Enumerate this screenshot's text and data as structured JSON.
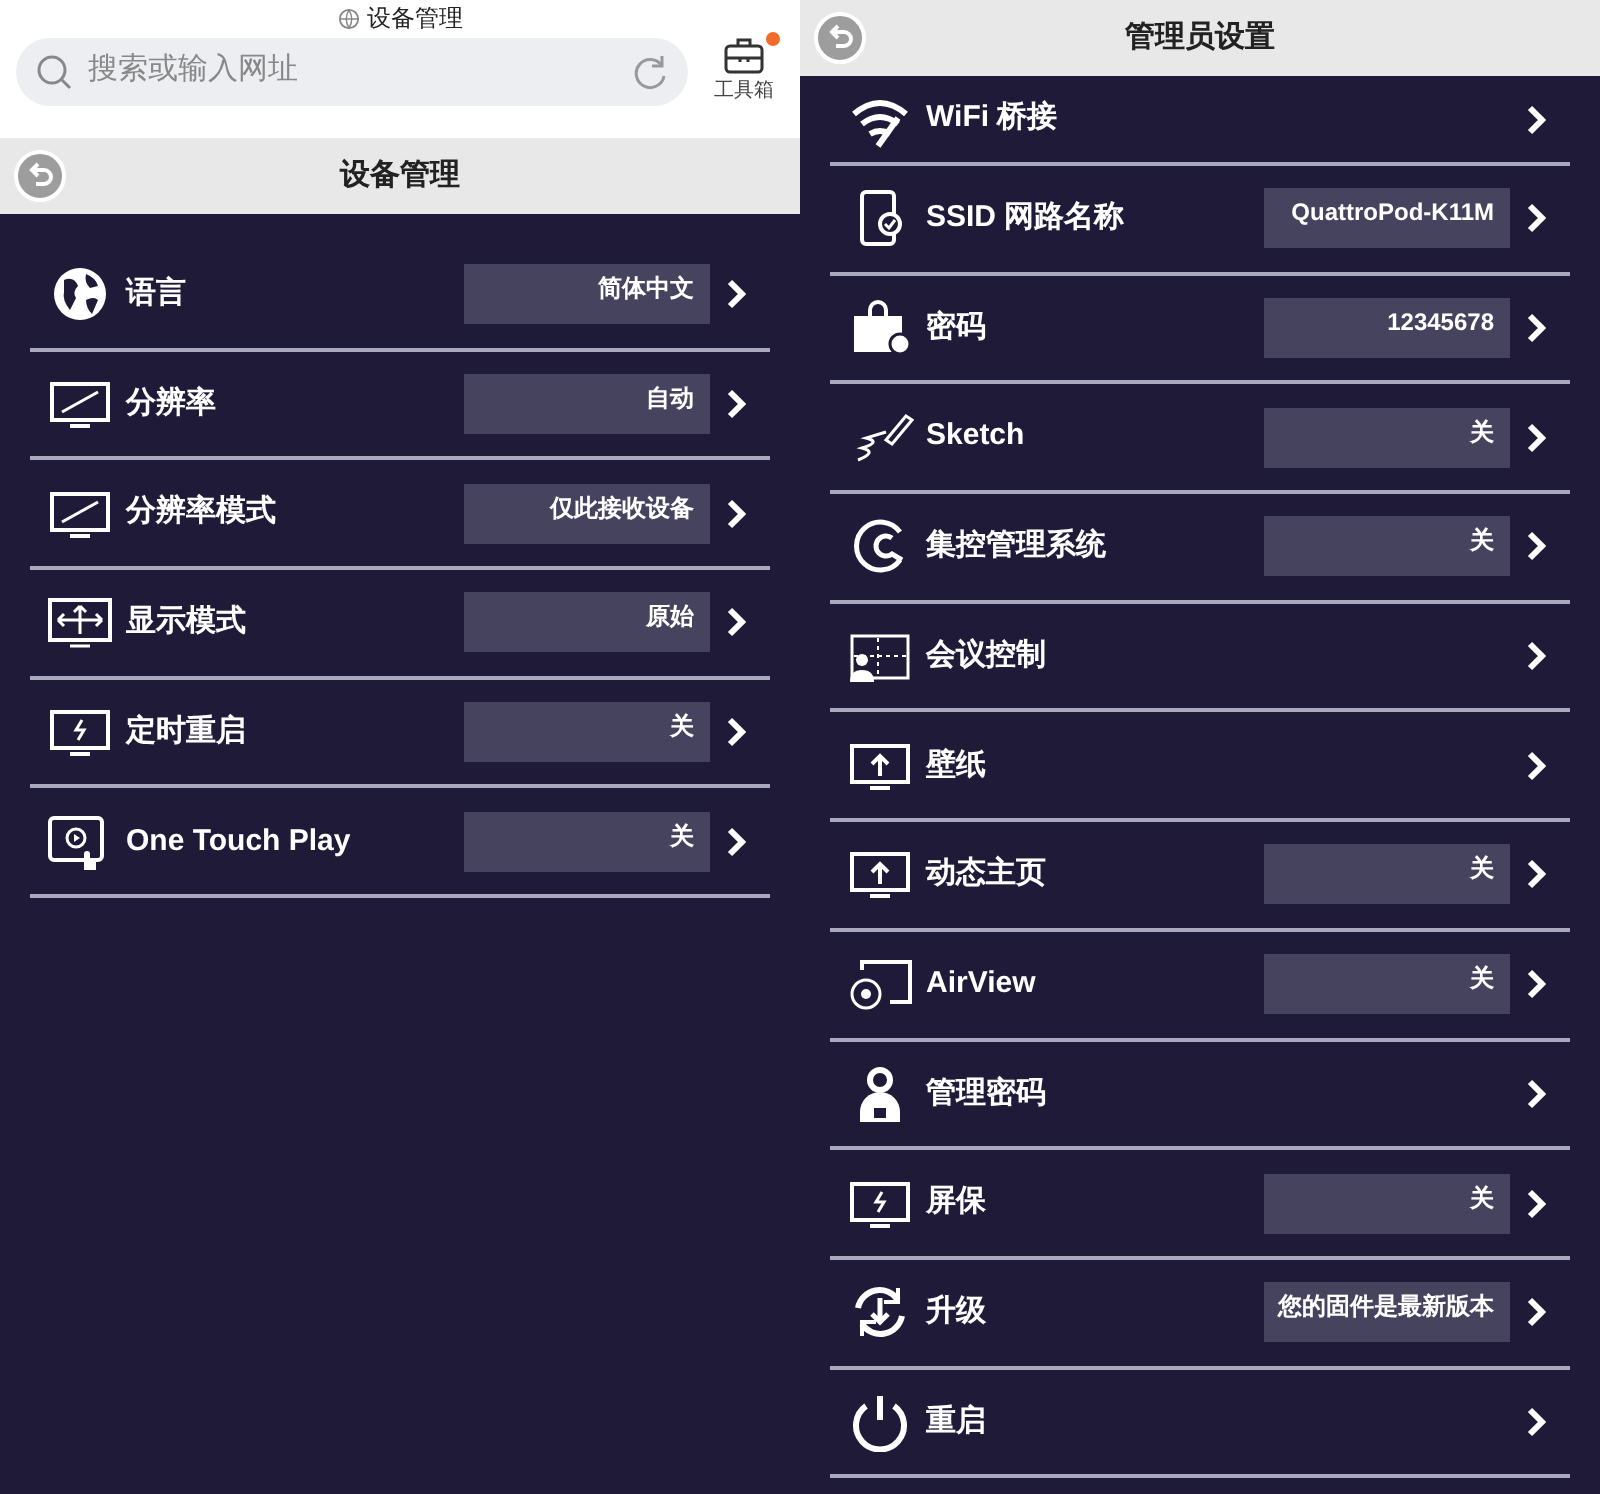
{
  "browser": {
    "page_title": "设备管理",
    "address_placeholder": "搜索或输入网址",
    "toolbox_label": "工具箱",
    "toolbox_badge": true
  },
  "left_panel": {
    "title": "设备管理",
    "rows": [
      {
        "label": "语言",
        "value": "简体中文"
      },
      {
        "label": "分辨率",
        "value": "自动"
      },
      {
        "label": "分辨率模式",
        "value": "仅此接收设备"
      },
      {
        "label": "显示模式",
        "value": "原始"
      },
      {
        "label": "定时重启",
        "value": "关"
      },
      {
        "label": "One Touch Play",
        "value": "关"
      }
    ]
  },
  "right_panel": {
    "title": "管理员设置",
    "rows": [
      {
        "label": "WiFi 桥接"
      },
      {
        "label": "SSID 网路名称",
        "value": "QuattroPod-K11M"
      },
      {
        "label": "密码",
        "value": "12345678"
      },
      {
        "label": "Sketch",
        "value": "关"
      },
      {
        "label": "集控管理系统",
        "value": "关"
      },
      {
        "label": "会议控制"
      },
      {
        "label": "壁纸"
      },
      {
        "label": "动态主页",
        "value": "关"
      },
      {
        "label": "AirView",
        "value": "关"
      },
      {
        "label": "管理密码"
      },
      {
        "label": "屏保",
        "value": "关"
      },
      {
        "label": "升级",
        "value": "您的固件是最新版本"
      },
      {
        "label": "重启"
      }
    ]
  }
}
